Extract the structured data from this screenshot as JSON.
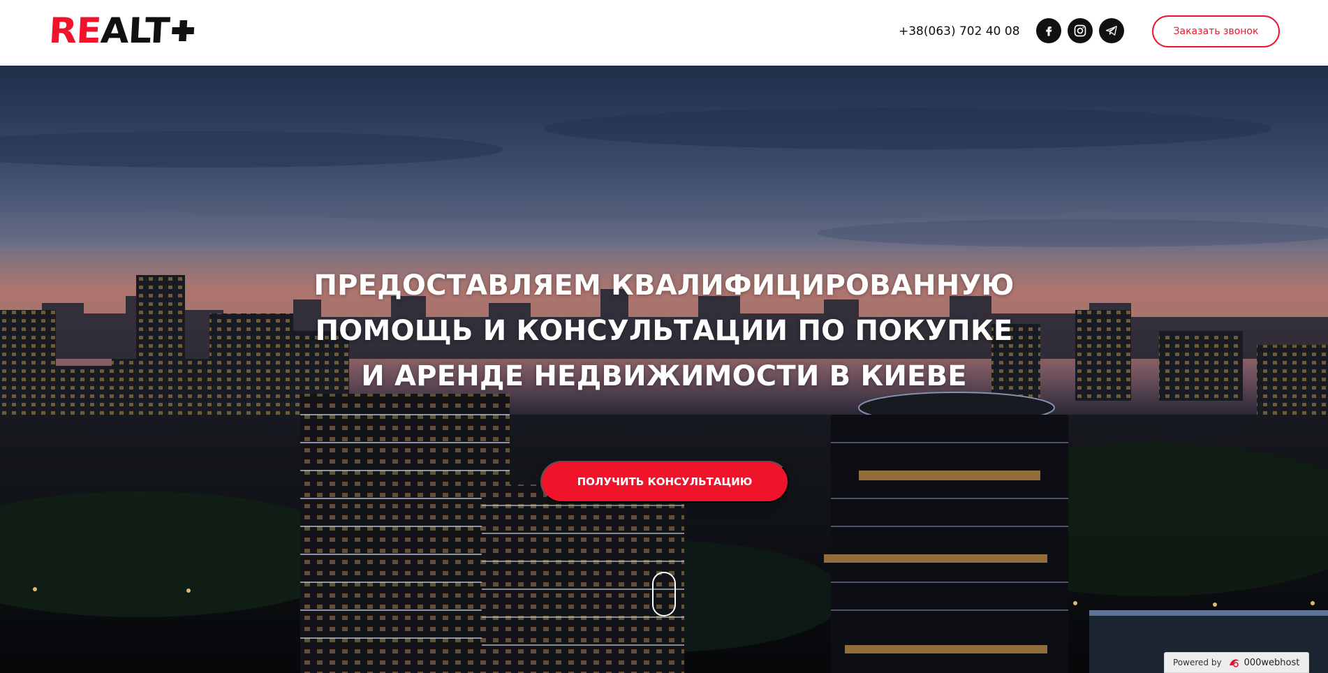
{
  "header": {
    "logo": {
      "part1": "RE",
      "part2": "ALT",
      "accent_color": "#f0142b"
    },
    "phone": "+38(063) 702 40 08",
    "social": [
      {
        "name": "facebook",
        "icon": "facebook-icon"
      },
      {
        "name": "instagram",
        "icon": "instagram-icon"
      },
      {
        "name": "telegram",
        "icon": "telegram-icon"
      }
    ],
    "callback_button": "Заказать звонок"
  },
  "hero": {
    "title_lines": [
      "ПРЕДОСТАВЛЯЕМ КВАЛИФИЦИРОВАННУЮ",
      "ПОМОЩЬ И КОНСУЛЬТАЦИИ ПО ПОКУПКЕ",
      "И АРЕНДЕ НЕДВИЖИМОСТИ В КИЕВЕ"
    ],
    "cta_button": "ПОЛУЧИТЬ КОНСУЛЬТАЦИЮ",
    "background": "night-city-skyline-image",
    "scroll_indicator": "mouse-scroll-icon"
  },
  "footer_badge": {
    "powered_label": "Powered by",
    "brand": "000webhost"
  },
  "colors": {
    "accent": "#f0142b",
    "text_dark": "#111111",
    "text_light": "#ffffff"
  }
}
